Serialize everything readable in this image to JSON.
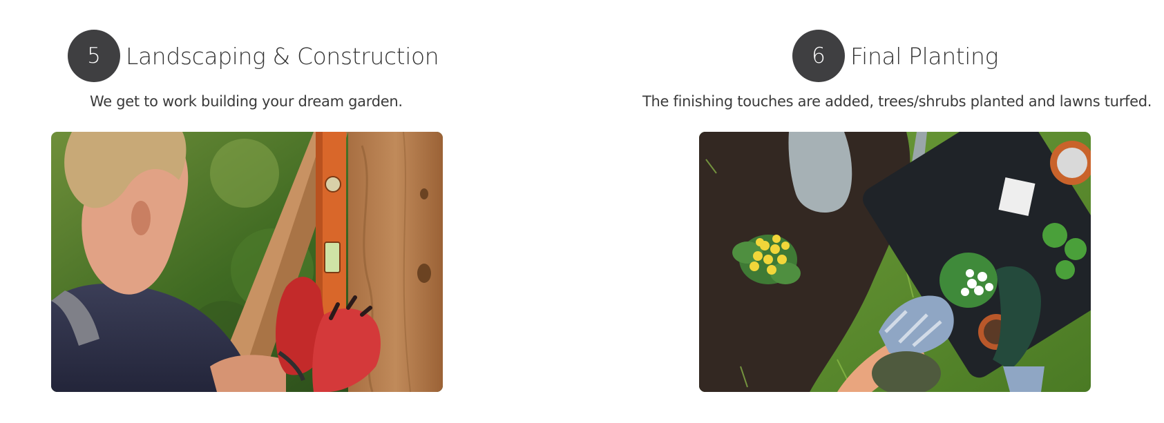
{
  "steps": [
    {
      "number": "5",
      "title": "Landscaping & Construction",
      "subtitle": "We get to work building your dream garden.",
      "image_subject": "person checking wooden post with spirit level wearing red gloves"
    },
    {
      "number": "6",
      "title": "Final Planting",
      "subtitle": "The finishing touches are added, trees/shrubs planted and lawns turfed.",
      "image_subject": "gloved hands planting flowers in soil with trowel and hand fork"
    }
  ],
  "colors": {
    "badge_bg": "#3f3f41",
    "badge_text": "#ffffff",
    "text": "#333333",
    "background": "#ffffff"
  }
}
